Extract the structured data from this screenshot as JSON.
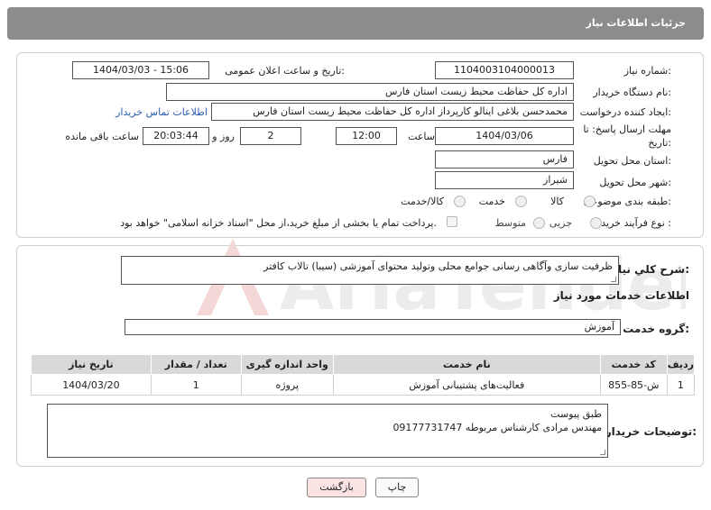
{
  "header": {
    "title": "جزئیات اطلاعات نیاز"
  },
  "form": {
    "need_number_label": "شماره نیاز:",
    "need_number": "1104003104000013",
    "announce_label": "تاریخ و ساعت اعلان عمومی:",
    "announce_value": "1404/03/03 - 15:06",
    "buyer_org_label": "نام دستگاه خریدار:",
    "buyer_org": "اداره کل حفاظت محیط زیست استان فارس",
    "creator_label": "ایجاد کننده درخواست:",
    "creator": "محمدحسن بلاغی اینالو کارپرداز اداره کل حفاظت محیط زیست استان فارس",
    "contact_link": "اطلاعات تماس خریدار",
    "deadline_label": "مهلت ارسال پاسخ: تا تاریخ:",
    "deadline_date": "1404/03/06",
    "time_label": "ساعت",
    "deadline_time": "12:00",
    "days_value": "2",
    "days_label": "روز و",
    "remaining_time": "20:03:44",
    "remaining_label": "ساعت باقی مانده",
    "province_label": "استان محل تحویل:",
    "province": "فارس",
    "city_label": "شهر محل تحویل:",
    "city": "شیراز",
    "category_label": "طبقه بندی موضوعی:",
    "category_options": [
      "کالا",
      "خدمت",
      "کالا/خدمت"
    ],
    "process_label": "نوع فرآیند خرید :",
    "process_options": [
      "جزیی",
      "متوسط"
    ],
    "payment_text": "پرداخت تمام یا بخشی از مبلغ خرید،از محل \"اسناد خزانه اسلامی\" خواهد بود."
  },
  "summary": {
    "label": "شرح کلي نياز:",
    "value": "ظرفیت سازی وآگاهی رسانی جوامع محلی وتولید محتوای آموزشی (سیبا) تالاب کافتر"
  },
  "services": {
    "section_title": "اطلاعات خدمات مورد نياز",
    "group_label": "گروه خدمت:",
    "group_value": "آموزش",
    "columns": [
      "ردیف",
      "کد خدمت",
      "نام خدمت",
      "واحد اندازه گیری",
      "تعداد / مقدار",
      "تاریخ نیاز"
    ],
    "rows": [
      {
        "index": "1",
        "code": "ش-85-855",
        "name": "فعالیت‌های پشتیبانی آموزش",
        "unit": "پروژه",
        "qty": "1",
        "date": "1404/03/20"
      }
    ]
  },
  "buyer_notes": {
    "label": "توضيحات خريدار:",
    "line1": "طبق پیوست",
    "line2": "09177731747 مهندس مرادی کارشناس مربوطه"
  },
  "buttons": {
    "print": "چاپ",
    "back": "بازگشت"
  },
  "watermark": {
    "text": "AriaTender.neT"
  }
}
